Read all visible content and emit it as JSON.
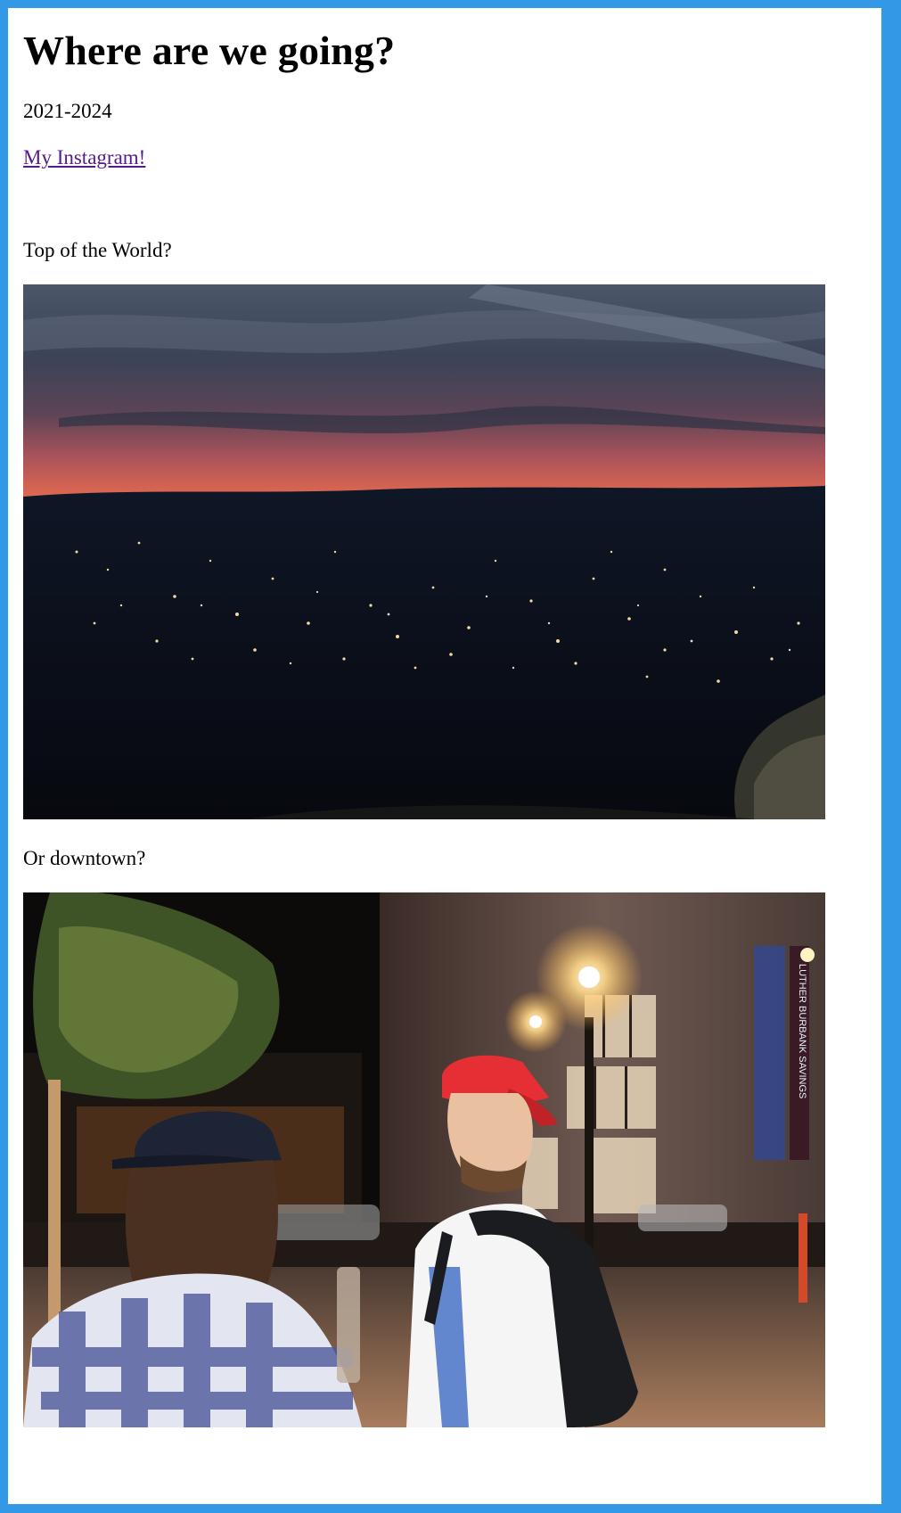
{
  "page": {
    "title": "Where are we going?",
    "years": "2021-2024",
    "instagram_link": "My Instagram!"
  },
  "sections": [
    {
      "caption": "Top of the World?",
      "image_alt": "city-lights-at-dusk-photo"
    },
    {
      "caption": "Or downtown?",
      "image_alt": "two-friends-downtown-at-night-photo",
      "sign_text": "LUTHER BURBANK SAVINGS"
    }
  ],
  "colors": {
    "frame": "#3399e6",
    "link": "#551a8b"
  }
}
